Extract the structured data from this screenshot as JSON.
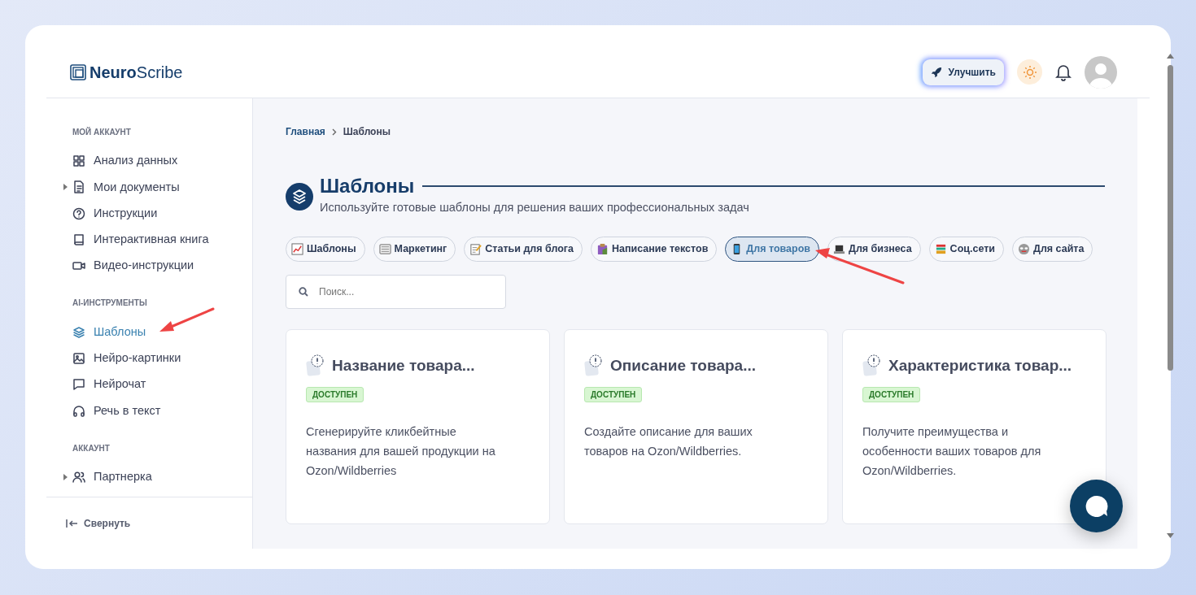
{
  "logo": {
    "bold": "Neuro",
    "light": "Scribe"
  },
  "header": {
    "upgrade_button": "Улучшить"
  },
  "sidebar": {
    "sections": [
      {
        "title": "МОЙ АККАУНТ",
        "items": [
          {
            "label": "Анализ данных",
            "kind": "grid",
            "expandable": false,
            "selected": false
          },
          {
            "label": "Мои документы",
            "kind": "document",
            "expandable": true,
            "selected": false
          },
          {
            "label": "Инструкции",
            "kind": "question",
            "expandable": false,
            "selected": false
          },
          {
            "label": "Интерактивная книга",
            "kind": "book",
            "expandable": false,
            "selected": false
          },
          {
            "label": "Видео-инструкции",
            "kind": "video",
            "expandable": false,
            "selected": false
          }
        ]
      },
      {
        "title": "AI-ИНСТРУМЕНТЫ",
        "items": [
          {
            "label": "Шаблоны",
            "kind": "layers",
            "expandable": false,
            "selected": true
          },
          {
            "label": "Нейро-картинки",
            "kind": "image",
            "expandable": false,
            "selected": false
          },
          {
            "label": "Нейрочат",
            "kind": "chat",
            "expandable": false,
            "selected": false
          },
          {
            "label": "Речь в текст",
            "kind": "headphones",
            "expandable": false,
            "selected": false
          }
        ]
      },
      {
        "title": "АККАУНТ",
        "items": [
          {
            "label": "Партнерка",
            "kind": "users",
            "expandable": true,
            "selected": false
          }
        ]
      }
    ],
    "collapse": "Свернуть"
  },
  "breadcrumb": [
    "Главная",
    "Шаблоны"
  ],
  "page": {
    "title": "Шаблоны",
    "subtitle": "Используйте готовые шаблоны для решения ваших профессиональных задач"
  },
  "chips": [
    {
      "label": "Шаблоны",
      "kind": "chart",
      "selected": false
    },
    {
      "label": "Маркетинг",
      "kind": "newspaper",
      "selected": false
    },
    {
      "label": "Статьи для блога",
      "kind": "memo",
      "selected": false
    },
    {
      "label": "Написание текстов",
      "kind": "clipboard",
      "selected": false
    },
    {
      "label": "Для товаров",
      "kind": "phone",
      "selected": true
    },
    {
      "label": "Для бизнеса",
      "kind": "laptop",
      "selected": false
    },
    {
      "label": "Соц.сети",
      "kind": "books",
      "selected": false
    },
    {
      "label": "Для сайта",
      "kind": "mask",
      "selected": false
    }
  ],
  "search": {
    "placeholder": "Поиск..."
  },
  "cards": [
    {
      "title": "Название товара...",
      "status": "ДОСТУПЕН",
      "description": "Сгенерируйте кликбейтные названия для вашей продукции на Ozon/Wildberries"
    },
    {
      "title": "Описание товара...",
      "status": "ДОСТУПЕН",
      "description": "Создайте описание для ваших товаров на Ozon/Wildberries."
    },
    {
      "title": "Характеристика товар...",
      "status": "ДОСТУПЕН",
      "description": "Получите преимущества и особенности ваших товаров для Ozon/Wildberries."
    }
  ]
}
